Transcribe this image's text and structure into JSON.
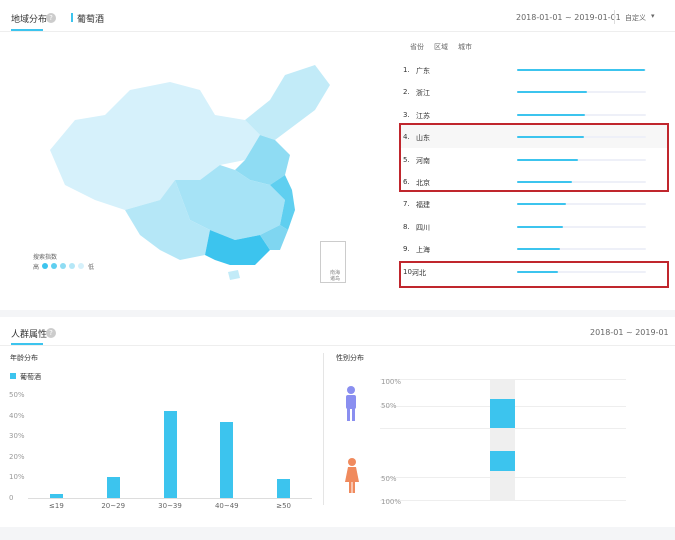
{
  "geo": {
    "tab_title": "地域分布",
    "help": "?",
    "legend_series": "葡萄酒",
    "date_range": "2018-01-01 ~ 2019-01-01",
    "custom_label": "自定义",
    "caret": "▾",
    "filters": [
      "省份",
      "区域",
      "城市"
    ],
    "map_legend": {
      "title": "搜索指数",
      "high": "高",
      "low": "低"
    },
    "inset_label": "南海\n诸岛",
    "ranking": [
      {
        "rank": "1.",
        "name": "广东",
        "value": 0.99
      },
      {
        "rank": "2.",
        "name": "浙江",
        "value": 0.54
      },
      {
        "rank": "3.",
        "name": "江苏",
        "value": 0.53
      },
      {
        "rank": "4.",
        "name": "山东",
        "value": 0.52
      },
      {
        "rank": "5.",
        "name": "河南",
        "value": 0.47
      },
      {
        "rank": "6.",
        "name": "北京",
        "value": 0.43
      },
      {
        "rank": "7.",
        "name": "福建",
        "value": 0.38
      },
      {
        "rank": "8.",
        "name": "四川",
        "value": 0.36
      },
      {
        "rank": "9.",
        "name": "上海",
        "value": 0.33
      },
      {
        "rank": "10.",
        "name": "河北",
        "value": 0.32
      }
    ]
  },
  "crowd": {
    "tab_title": "人群属性",
    "help": "?",
    "date_range": "2018-01 ~ 2019-01",
    "age": {
      "title": "年龄分布",
      "legend": "葡萄酒"
    },
    "gender": {
      "title": "性别分布",
      "male_icon": "male-icon",
      "female_icon": "female-icon"
    }
  },
  "colors": {
    "accent": "#3cc4ee",
    "highlight_box": "#c0262d",
    "male": "#8a8ff0",
    "female": "#f08a5d"
  },
  "chart_data": [
    {
      "type": "bar",
      "title": "年龄分布",
      "categories": [
        "≤19",
        "20~29",
        "30~39",
        "40~49",
        "≥50"
      ],
      "series": [
        {
          "name": "葡萄酒",
          "values": [
            2,
            10,
            42,
            37,
            9
          ]
        }
      ],
      "yticks": [
        "0",
        "10%",
        "20%",
        "30%",
        "40%",
        "50%"
      ],
      "ylim": [
        0,
        50
      ],
      "grid": false,
      "legend": "top-left"
    },
    {
      "type": "bar",
      "title": "性别分布",
      "categories": [
        "男",
        "女"
      ],
      "values": [
        60,
        40
      ],
      "tick_labels_top": [
        "100%",
        "50%"
      ],
      "tick_labels_bottom": [
        "50%",
        "100%"
      ],
      "orientation": "mirrored"
    }
  ]
}
